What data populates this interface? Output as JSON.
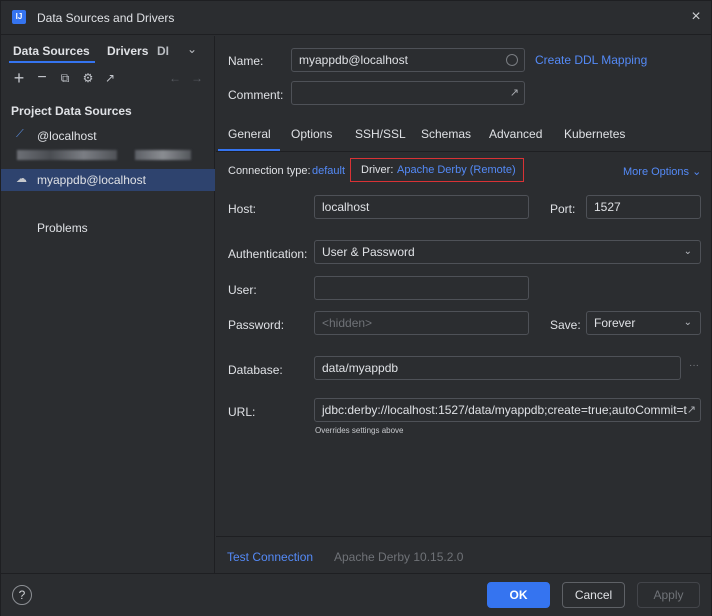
{
  "window": {
    "title": "Data Sources and Drivers",
    "app_icon": "IJ",
    "close_icon": "×"
  },
  "left": {
    "tabs": [
      {
        "label": "Data Sources",
        "active": true
      },
      {
        "label": "Drivers",
        "active": false
      },
      {
        "label": "DI",
        "active": false
      }
    ],
    "tab_overflow_icon": "⌄",
    "toolbar": {
      "add": "+",
      "remove": "−",
      "duplicate": "⧉",
      "settings": "⚙",
      "export": "↗",
      "back": "←",
      "forward": "→"
    },
    "section_title": "Project Data Sources",
    "items": [
      {
        "label": "@localhost",
        "icon": "⟋"
      },
      {
        "label": "myappdb@localhost",
        "icon": "☁",
        "selected": true
      }
    ],
    "problems_label": "Problems"
  },
  "right": {
    "name_label": "Name:",
    "name_value": "myappdb@localhost",
    "create_ddl_link": "Create DDL Mapping",
    "comment_label": "Comment:",
    "comment_expand_icon": "↗",
    "tabs": [
      "General",
      "Options",
      "SSH/SSL",
      "Schemas",
      "Advanced",
      "Kubernetes"
    ],
    "connection_type_label": "Connection type:",
    "connection_type_value": "default",
    "driver_label": "Driver:",
    "driver_value": "Apache Derby (Remote)",
    "more_options": "More Options",
    "more_options_chevron": "⌄",
    "host_label": "Host:",
    "host_value": "localhost",
    "port_label": "Port:",
    "port_value": "1527",
    "auth_label": "Authentication:",
    "auth_value": "User & Password",
    "user_label": "User:",
    "user_value": "",
    "password_label": "Password:",
    "password_placeholder": "<hidden>",
    "save_label": "Save:",
    "save_value": "Forever",
    "database_label": "Database:",
    "database_value": "data/myappdb",
    "database_more": "···",
    "url_label": "URL:",
    "url_value": "jdbc:derby://localhost:1527/data/myappdb;create=true;autoCommit=t",
    "url_expand_icon": "↗",
    "url_hint": "Overrides settings above",
    "test_connection": "Test Connection",
    "driver_version": "Apache Derby 10.15.2.0",
    "select_chevron": "⌄"
  },
  "footer": {
    "help": "?",
    "ok": "OK",
    "cancel": "Cancel",
    "apply": "Apply"
  },
  "colors": {
    "accent": "#3574f0",
    "link": "#548af7",
    "highlight_box": "#d93235",
    "selected_row": "#2e436e",
    "background": "#2b2d30"
  }
}
